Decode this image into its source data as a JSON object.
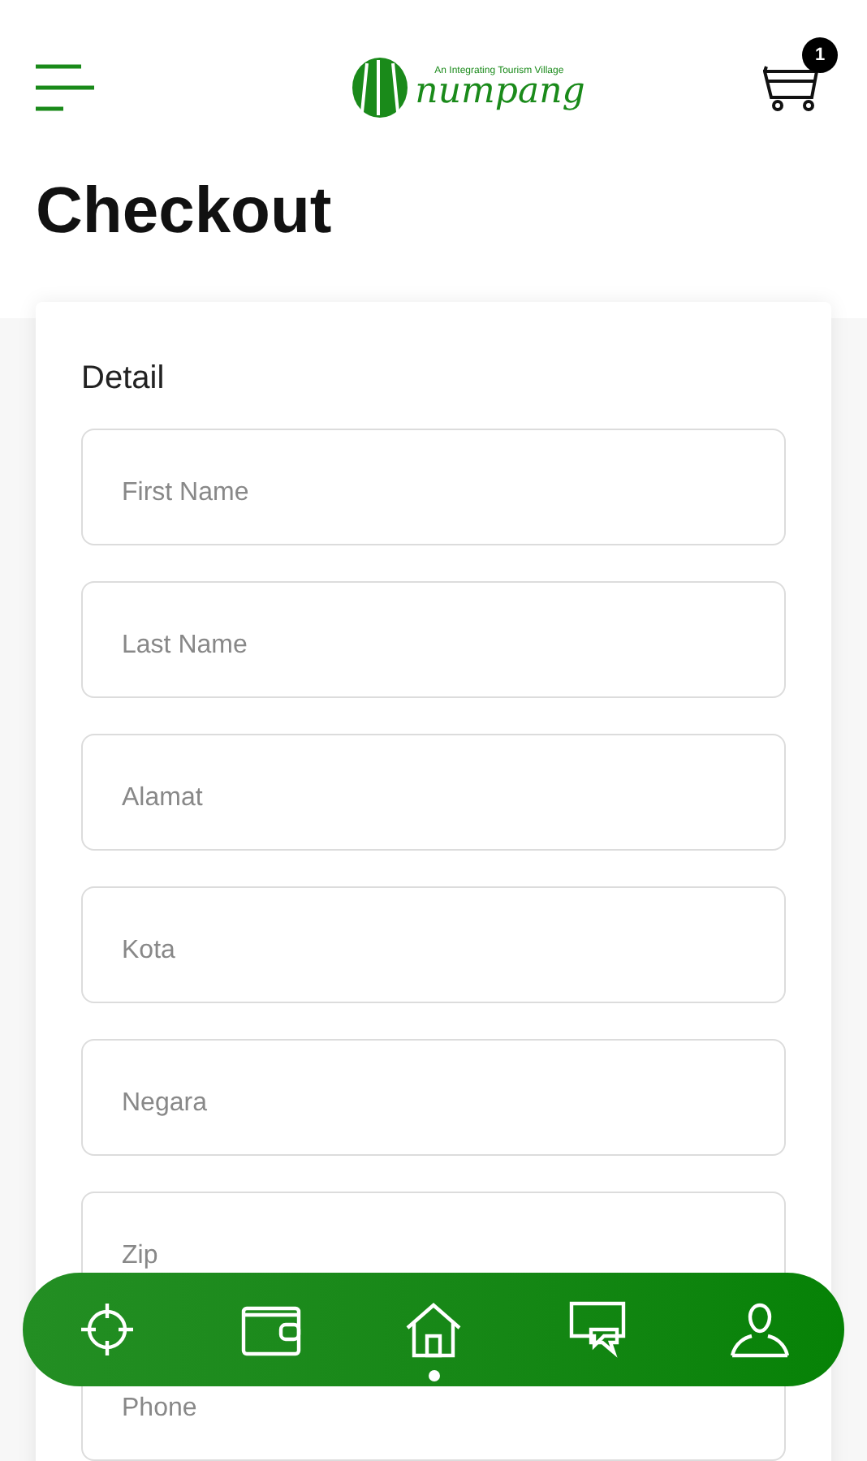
{
  "header": {
    "logo": {
      "tagline": "An Integrating Tourism Village",
      "name": "numpang"
    },
    "cart_count": "1"
  },
  "title": "Checkout",
  "form": {
    "section": "Detail",
    "fields": [
      {
        "placeholder": "First Name"
      },
      {
        "placeholder": "Last Name"
      },
      {
        "placeholder": "Alamat"
      },
      {
        "placeholder": "Kota"
      },
      {
        "placeholder": "Negara"
      },
      {
        "placeholder": "Zip"
      },
      {
        "placeholder": "Phone"
      }
    ]
  },
  "bottom_nav": [
    {
      "kind": "location",
      "selected": false
    },
    {
      "kind": "wallet",
      "selected": false
    },
    {
      "kind": "home",
      "selected": true
    },
    {
      "kind": "chat",
      "selected": false
    },
    {
      "kind": "profile",
      "selected": false
    }
  ]
}
